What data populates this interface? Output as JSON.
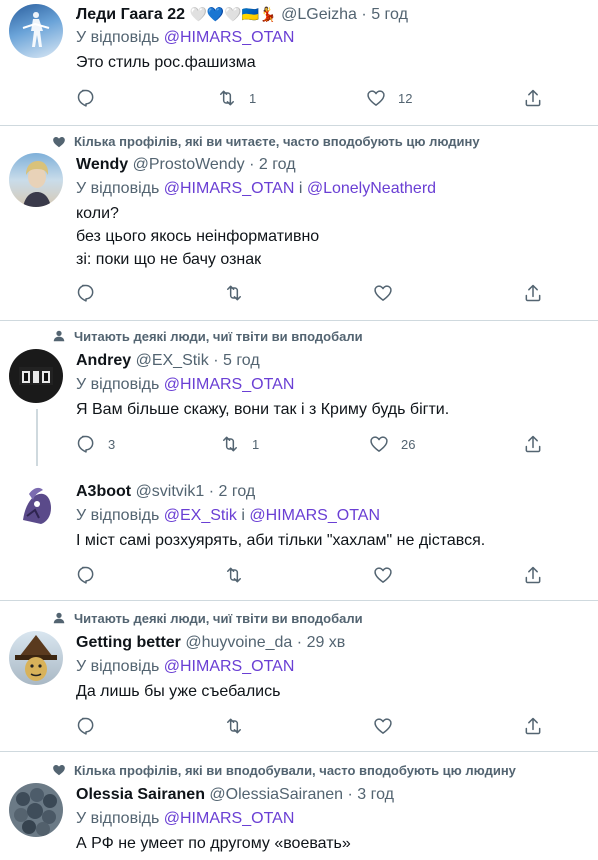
{
  "tweets": [
    {
      "name": "Леди Гаага 22",
      "name_emoji": "🤍💙🤍🇺🇦💃",
      "handle": "@LGeizha",
      "time": "5 год",
      "reply_prefix": "У відповідь",
      "mentions": [
        "@HIMARS_OTAN"
      ],
      "text_lines": [
        "Это стиль рос.фашизма"
      ],
      "retweets": "1",
      "likes": "12"
    },
    {
      "social": "Кілька профілів, які ви читаєте, часто вподобують цю людину",
      "name": "Wendy",
      "handle": "@ProstoWendy",
      "time": "2 год",
      "reply_prefix": "У відповідь",
      "mentions": [
        "@HIMARS_OTAN",
        "@LonelyNeatherd"
      ],
      "conj": "і",
      "text_lines": [
        "коли?",
        "без цього якось неінформативно",
        "зі: поки що не бачу ознак"
      ],
      "replies": "",
      "retweets": "",
      "likes": ""
    },
    {
      "social": "Читають деякі люди, чиї твіти ви вподобали",
      "name": "Andrey",
      "handle": "@EX_Stik",
      "time": "5 год",
      "reply_prefix": "У відповідь",
      "mentions": [
        "@HIMARS_OTAN"
      ],
      "text_lines": [
        "Я Вам більше скажу, вони так і з Криму будь бігти."
      ],
      "replies": "3",
      "retweets": "1",
      "likes": "26"
    },
    {
      "name": "A3boot",
      "handle": "@svitvik1",
      "time": "2 год",
      "reply_prefix": "У відповідь",
      "mentions": [
        "@EX_Stik",
        "@HIMARS_OTAN"
      ],
      "conj": "і",
      "text_lines": [
        "І міст самі розхуярять, аби тільки \"хахлам\" не дістався."
      ]
    },
    {
      "social": "Читають деякі люди, чиї твіти ви вподобали",
      "name": "Getting better",
      "handle": "@huyvoine_da",
      "time": "29 хв",
      "reply_prefix": "У відповідь",
      "mentions": [
        "@HIMARS_OTAN"
      ],
      "text_lines": [
        "Да лишь бы уже съебались"
      ]
    },
    {
      "social": "Кілька профілів, які ви вподобували, часто вподобують цю людину",
      "name": "Olessia Sairanen",
      "handle": "@OlessiaSairanen",
      "time": "3 год",
      "reply_prefix": "У відповідь",
      "mentions": [
        "@HIMARS_OTAN"
      ],
      "text_lines": [
        "А РФ не умеет по другому «воевать»"
      ]
    }
  ],
  "colors": {
    "secondary_text": "#536471",
    "mention": "#6a3fd4",
    "divider": "#cfd9de"
  },
  "icons": {
    "reply": "reply-icon",
    "retweet": "retweet-icon",
    "like": "heart-icon",
    "share": "share-icon",
    "social_heart": "heart-filled-icon",
    "social_person": "person-icon"
  }
}
